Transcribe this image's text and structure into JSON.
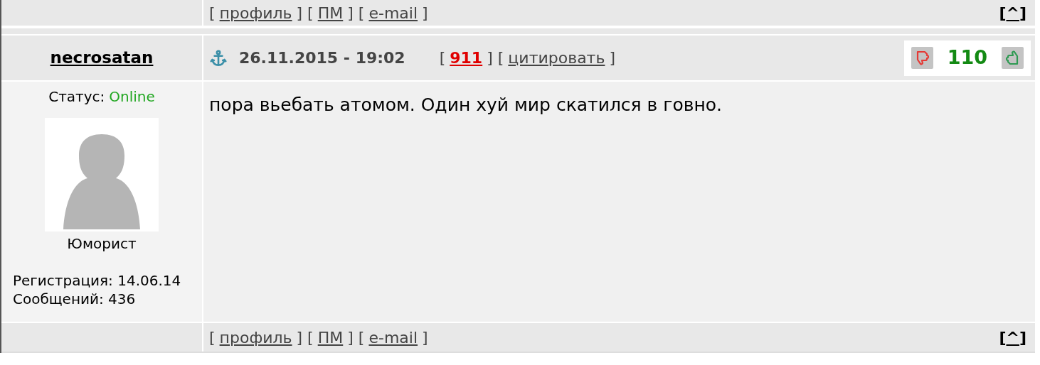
{
  "top_bar": {
    "links": [
      {
        "kind": "bracket",
        "text": "["
      },
      {
        "kind": "link",
        "text": "профиль"
      },
      {
        "kind": "bracket",
        "text": "] ["
      },
      {
        "kind": "link",
        "text": "ПМ"
      },
      {
        "kind": "bracket",
        "text": "] ["
      },
      {
        "kind": "link",
        "text": "e-mail"
      },
      {
        "kind": "bracket",
        "text": "]"
      }
    ],
    "to_top": [
      {
        "kind": "bracket",
        "text": "["
      },
      {
        "kind": "link",
        "text": "^"
      },
      {
        "kind": "bracket",
        "text": "]"
      }
    ]
  },
  "post": {
    "author": "necrosatan",
    "date": "26.11.2015 - 19:02",
    "meta": [
      {
        "kind": "bracket",
        "text": "["
      },
      {
        "kind": "number",
        "text": "911"
      },
      {
        "kind": "bracket",
        "text": "] ["
      },
      {
        "kind": "link",
        "text": "цитировать"
      },
      {
        "kind": "bracket",
        "text": "]"
      }
    ],
    "rating": "110",
    "status_label": "Статус:",
    "status": "Online",
    "rank": "Юморист",
    "registration": "Регистрация: 14.06.14",
    "messages": "Сообщений: 436",
    "text": "пора вьебать атомом. Один хуй мир скатился в говно."
  },
  "bottom_bar": {
    "links": [
      {
        "kind": "bracket",
        "text": "["
      },
      {
        "kind": "link",
        "text": "профиль"
      },
      {
        "kind": "bracket",
        "text": "] ["
      },
      {
        "kind": "link",
        "text": "ПМ"
      },
      {
        "kind": "bracket",
        "text": "] ["
      },
      {
        "kind": "link",
        "text": "e-mail"
      },
      {
        "kind": "bracket",
        "text": "]"
      }
    ],
    "to_top": [
      {
        "kind": "bracket",
        "text": "["
      },
      {
        "kind": "link",
        "text": "^"
      },
      {
        "kind": "bracket",
        "text": "]"
      }
    ]
  }
}
